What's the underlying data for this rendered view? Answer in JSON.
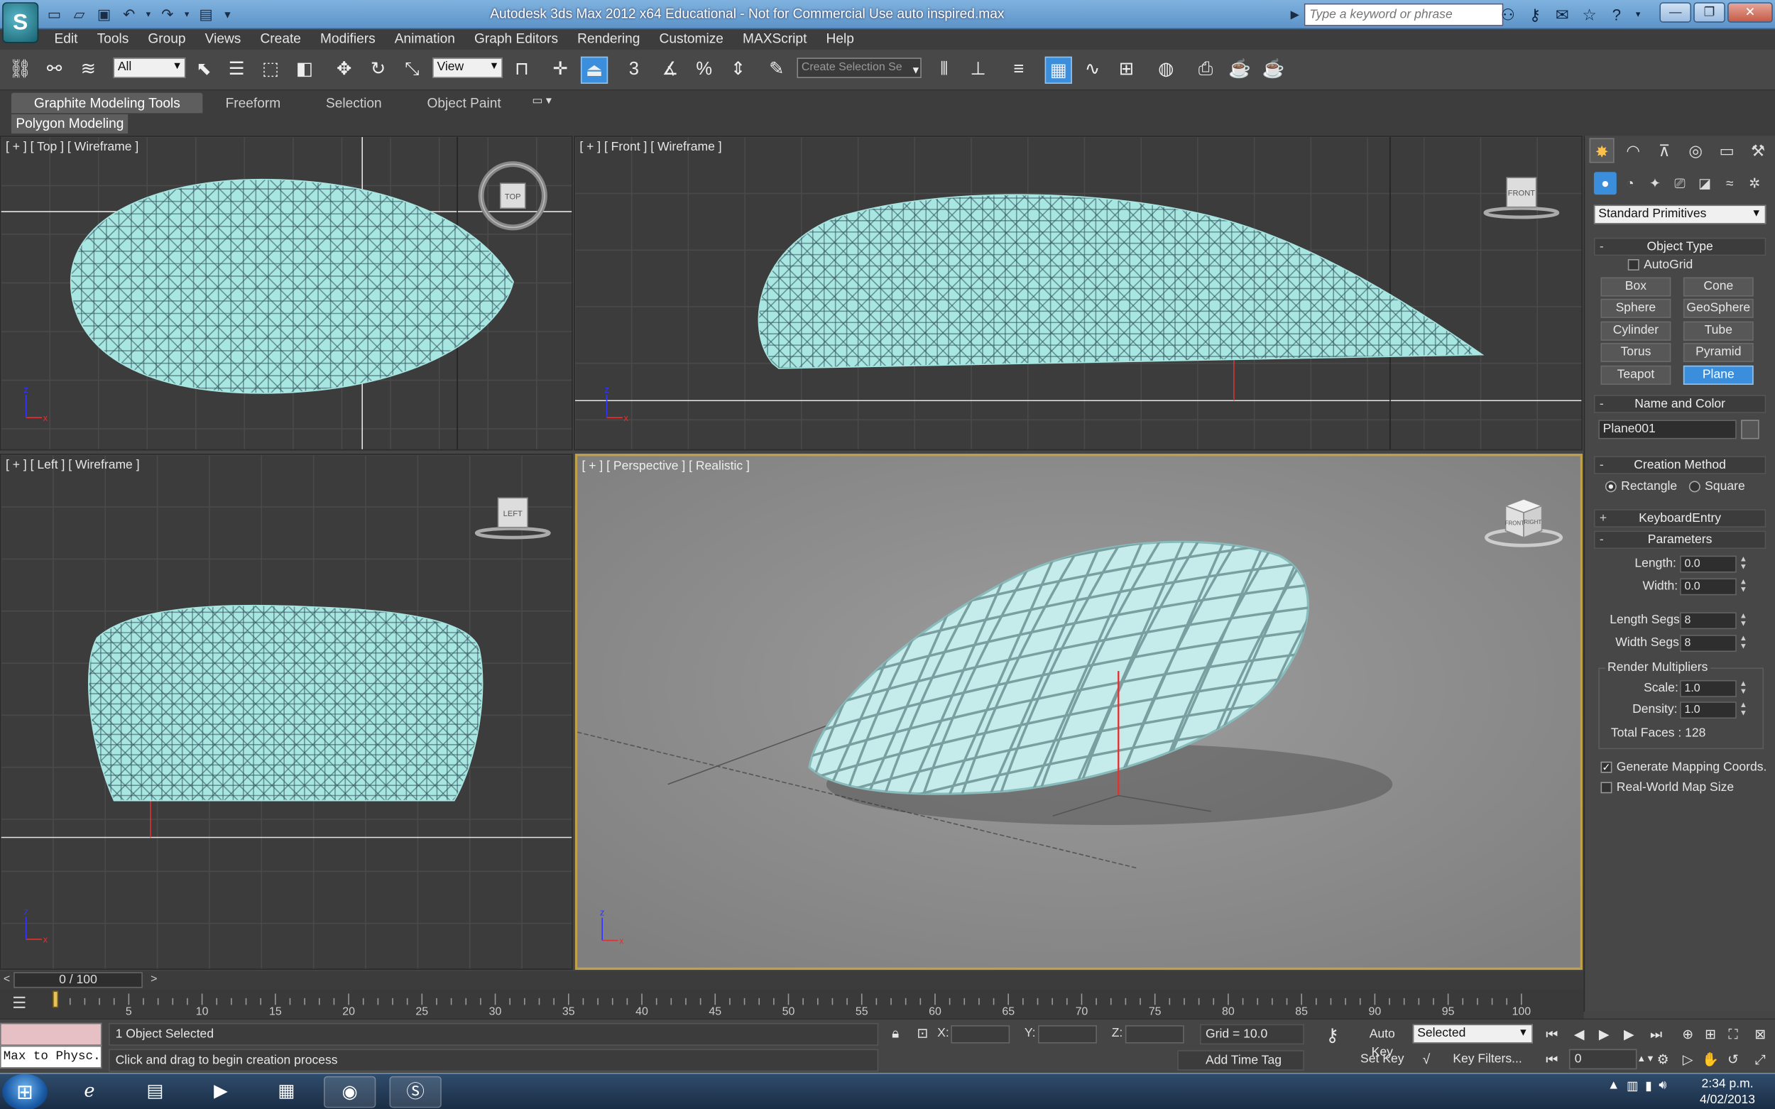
{
  "titlebar": {
    "app_logo": "S",
    "title": "Autodesk 3ds Max  2012 x64    Educational - Not for Commercial Use    auto inspired.max",
    "search_placeholder": "Type a keyword or phrase",
    "quick_access": [
      "new-icon",
      "open-icon",
      "save-icon",
      "undo-icon",
      "redo-icon",
      "project-icon"
    ],
    "window_buttons": [
      "minimize",
      "maximize",
      "close"
    ]
  },
  "menu": [
    "Edit",
    "Tools",
    "Group",
    "Views",
    "Create",
    "Modifiers",
    "Animation",
    "Graph Editors",
    "Rendering",
    "Customize",
    "MAXScript",
    "Help"
  ],
  "toolbar": {
    "selection_filter": "All",
    "reference_coord": "View",
    "named_selection_placeholder": "Create Selection Se",
    "snap_label": "3"
  },
  "ribbon": {
    "tabs": [
      "Graphite Modeling Tools",
      "Freeform",
      "Selection",
      "Object Paint"
    ],
    "active_tab": "Graphite Modeling Tools",
    "subtab": "Polygon Modeling"
  },
  "viewports": {
    "top": {
      "label": "[ + ] [ Top ] [ Wireframe ]",
      "cube": "TOP"
    },
    "front": {
      "label": "[ + ] [ Front ] [ Wireframe ]",
      "cube": "FRONT"
    },
    "left": {
      "label": "[ + ] [ Left ] [ Wireframe ]",
      "cube": "LEFT"
    },
    "perspective": {
      "label": "[ + ] [ Perspective ] [ Realistic ]",
      "cube_front": "FRONT",
      "cube_right": "RIGHT"
    },
    "axis": {
      "x": "x",
      "y": "y",
      "z": "z"
    },
    "mesh_color": "#a8e6e2",
    "active_border": "#c0a04a"
  },
  "command_panel": {
    "category_dropdown": "Standard Primitives",
    "object_type": {
      "title": "Object Type",
      "autogrid": "AutoGrid",
      "buttons": [
        "Box",
        "Cone",
        "Sphere",
        "GeoSphere",
        "Cylinder",
        "Tube",
        "Torus",
        "Pyramid",
        "Teapot",
        "Plane"
      ],
      "active": "Plane"
    },
    "name_and_color": {
      "title": "Name and Color",
      "name": "Plane001"
    },
    "creation_method": {
      "title": "Creation Method",
      "options": [
        "Rectangle",
        "Square"
      ],
      "selected": "Rectangle"
    },
    "keyboard_entry": {
      "title": "KeyboardEntry"
    },
    "parameters": {
      "title": "Parameters",
      "length_label": "Length:",
      "length": "0.0",
      "width_label": "Width:",
      "width": "0.0",
      "length_segs_label": "Length Segs:",
      "length_segs": "8",
      "width_segs_label": "Width Segs:",
      "width_segs": "8",
      "render_multipliers": "Render Multipliers",
      "scale_label": "Scale:",
      "scale": "1.0",
      "density_label": "Density:",
      "density": "1.0",
      "total_faces": "Total Faces : 128",
      "gen_mapping": "Generate Mapping Coords.",
      "gen_mapping_checked": true,
      "real_world": "Real-World Map Size",
      "real_world_checked": false
    }
  },
  "timeline": {
    "frame_display": "0 / 100",
    "current_frame": 0,
    "start": 0,
    "end": 100,
    "tick_labels": [
      "5",
      "10",
      "15",
      "20",
      "25",
      "30",
      "35",
      "40",
      "45",
      "50",
      "55",
      "60",
      "65",
      "70",
      "75",
      "80",
      "85",
      "90",
      "95",
      "100"
    ]
  },
  "status": {
    "maxscript_label": "Max to Physc.",
    "selection": "1 Object Selected",
    "prompt": "Click and drag to begin creation process",
    "x_label": "X:",
    "y_label": "Y:",
    "z_label": "Z:",
    "grid": "Grid = 10.0",
    "add_time_tag": "Add Time Tag",
    "auto_key": "Auto Key",
    "set_key": "Set Key",
    "key_mode": "Selected",
    "key_filters": "Key Filters...",
    "frame_field": "0"
  },
  "taskbar": {
    "apps": [
      "ie-icon",
      "explorer-icon",
      "media-player-icon",
      "project-icon",
      "firefox-icon",
      "3dsmax-icon"
    ],
    "time": "2:34 p.m.",
    "date": "4/02/2013"
  }
}
